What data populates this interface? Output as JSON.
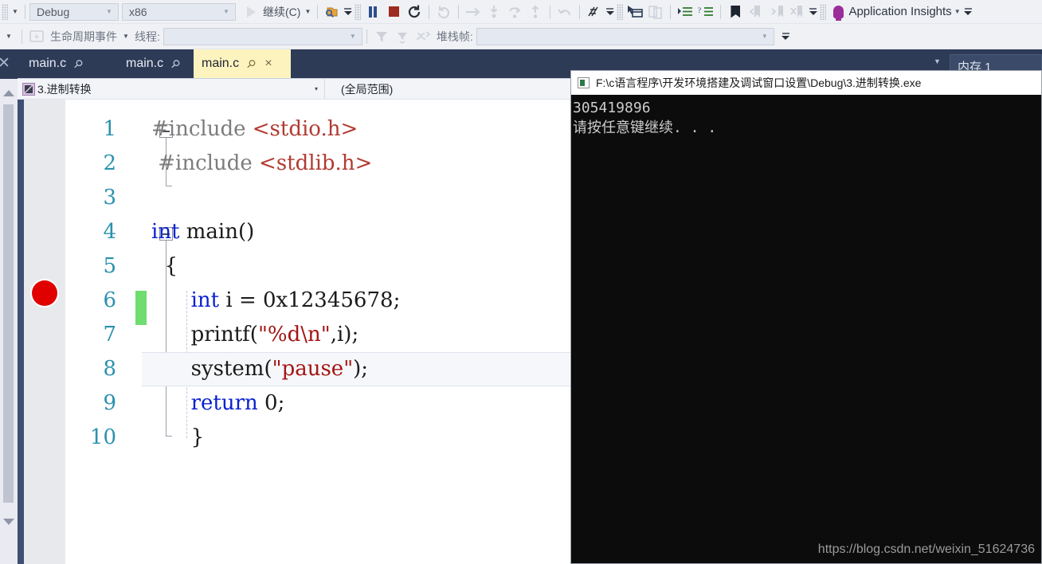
{
  "toolbar1": {
    "config_combo": "Debug",
    "platform_combo": "x86",
    "continue_label": "继续(C)",
    "app_insights_label": "Application Insights",
    "icons": [
      "dropdown-caret-icon",
      "play-icon",
      "pause-icon",
      "stop-icon",
      "restart-icon",
      "show-next-statement-icon",
      "step-over-icon",
      "step-into-icon",
      "step-out-icon",
      "step-out-alt-icon",
      "undo-icon",
      "hex-display-icon",
      "thread-window-icon",
      "parallel-watch-icon",
      "indent-icon",
      "comment-icon",
      "bookmark-icon",
      "prev-bookmark-icon",
      "next-bookmark-icon",
      "clear-bookmarks-icon",
      "lightbulb-icon"
    ]
  },
  "toolbar2": {
    "lifecycle_events_label": "生命周期事件",
    "thread_label": "线程:",
    "thread_value": "",
    "stackframe_label": "堆栈帧:",
    "stackframe_value": "",
    "icons": [
      "lifecycle-icon",
      "filter-icon",
      "filter-clear-icon",
      "flatten-icon"
    ]
  },
  "tabs": [
    {
      "label": "main.c",
      "active": false,
      "pin": "pin-icon"
    },
    {
      "label": "main.c",
      "active": false,
      "pin": "pin-icon"
    },
    {
      "label": "main.c",
      "active": true,
      "pin": "pin-icon",
      "close": "×"
    }
  ],
  "memory_tab": {
    "label": "内存 1"
  },
  "navbar": {
    "project_scope": "3.进制转换",
    "member_scope": "(全局范围)",
    "caret": "▾"
  },
  "editor": {
    "breakpoint_line": 6,
    "current_line": 8,
    "changed_lines": [
      6
    ],
    "line_numbers": [
      "1",
      "2",
      "3",
      "4",
      "5",
      "6",
      "7",
      "8",
      "9",
      "10"
    ],
    "lines": [
      {
        "n": 1,
        "tokens": [
          {
            "t": "#include ",
            "c": "pp"
          },
          {
            "t": "<stdio.h>",
            "c": "hdr"
          }
        ]
      },
      {
        "n": 2,
        "tokens": [
          {
            "t": "#include ",
            "c": "pp"
          },
          {
            "t": "<stdlib.h>",
            "c": "hdr"
          }
        ]
      },
      {
        "n": 3,
        "tokens": []
      },
      {
        "n": 4,
        "tokens": [
          {
            "t": "int",
            "c": "kw"
          },
          {
            "t": " main()",
            "c": "pl"
          }
        ]
      },
      {
        "n": 5,
        "tokens": [
          {
            "t": "{",
            "c": "pl"
          }
        ]
      },
      {
        "n": 6,
        "tokens": [
          {
            "t": "    ",
            "c": "pl"
          },
          {
            "t": "int",
            "c": "kw"
          },
          {
            "t": " i = ",
            "c": "pl"
          },
          {
            "t": "0x12345678",
            "c": "num"
          },
          {
            "t": ";",
            "c": "pl"
          }
        ]
      },
      {
        "n": 7,
        "tokens": [
          {
            "t": "    printf(",
            "c": "pl"
          },
          {
            "t": "\"%d\\n\"",
            "c": "str"
          },
          {
            "t": ",i);",
            "c": "pl"
          }
        ]
      },
      {
        "n": 8,
        "tokens": [
          {
            "t": "    system(",
            "c": "pl"
          },
          {
            "t": "\"pause\"",
            "c": "str"
          },
          {
            "t": ");",
            "c": "pl"
          }
        ]
      },
      {
        "n": 9,
        "tokens": [
          {
            "t": "    ",
            "c": "pl"
          },
          {
            "t": "return",
            "c": "kw"
          },
          {
            "t": " 0;",
            "c": "pl"
          }
        ]
      },
      {
        "n": 10,
        "tokens": [
          {
            "t": "    }",
            "c": "pl"
          }
        ]
      }
    ]
  },
  "console": {
    "title": "F:\\c语言程序\\开发环境搭建及调试窗口设置\\Debug\\3.进制转换.exe",
    "icon": "console-window-icon",
    "output_lines": [
      "305419896",
      "请按任意键继续. . ."
    ]
  },
  "watermark": "https://blog.csdn.net/weixin_51624736",
  "colors": {
    "tabstrip_bg": "#2d3b57",
    "active_tab_bg": "#fdf3bf",
    "toolbar_bg": "#eff1f5",
    "breakpoint_red": "#e10000",
    "change_marker_green": "#6fdd6f",
    "keyword_blue": "#0b21d1",
    "string_red": "#a31515",
    "header_red": "#b23a32",
    "linenum_teal": "#2b91af",
    "console_bg": "#0c0c0c"
  }
}
